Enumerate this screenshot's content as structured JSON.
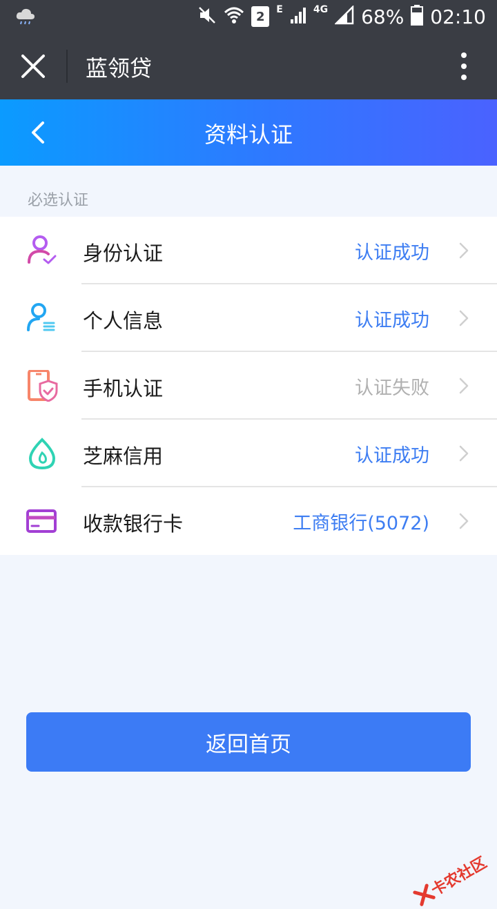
{
  "status_bar": {
    "sim_number": "2",
    "network_e": "E",
    "network_4g": "4G",
    "battery": "68%",
    "time": "02:10"
  },
  "app_bar": {
    "title": "蓝领贷"
  },
  "header": {
    "title": "资料认证"
  },
  "section": {
    "label": "必选认证"
  },
  "items": [
    {
      "label": "身份认证",
      "status": "认证成功",
      "state": "success",
      "icon": "identity-icon"
    },
    {
      "label": "个人信息",
      "status": "认证成功",
      "state": "success",
      "icon": "personal-info-icon"
    },
    {
      "label": "手机认证",
      "status": "认证失败",
      "state": "failed",
      "icon": "phone-shield-icon"
    },
    {
      "label": "芝麻信用",
      "status": "认证成功",
      "state": "success",
      "icon": "sesame-credit-icon"
    },
    {
      "label": "收款银行卡",
      "status": "工商银行(5072)",
      "state": "success",
      "icon": "bank-card-icon"
    }
  ],
  "primary_button": {
    "label": "返回首页"
  },
  "watermark": {
    "text": "卡农社区"
  },
  "colors": {
    "accent": "#3c7bf5",
    "success_text": "#3d7df2",
    "fail_text": "#b0b0b0",
    "appbar": "#3a3d44"
  }
}
